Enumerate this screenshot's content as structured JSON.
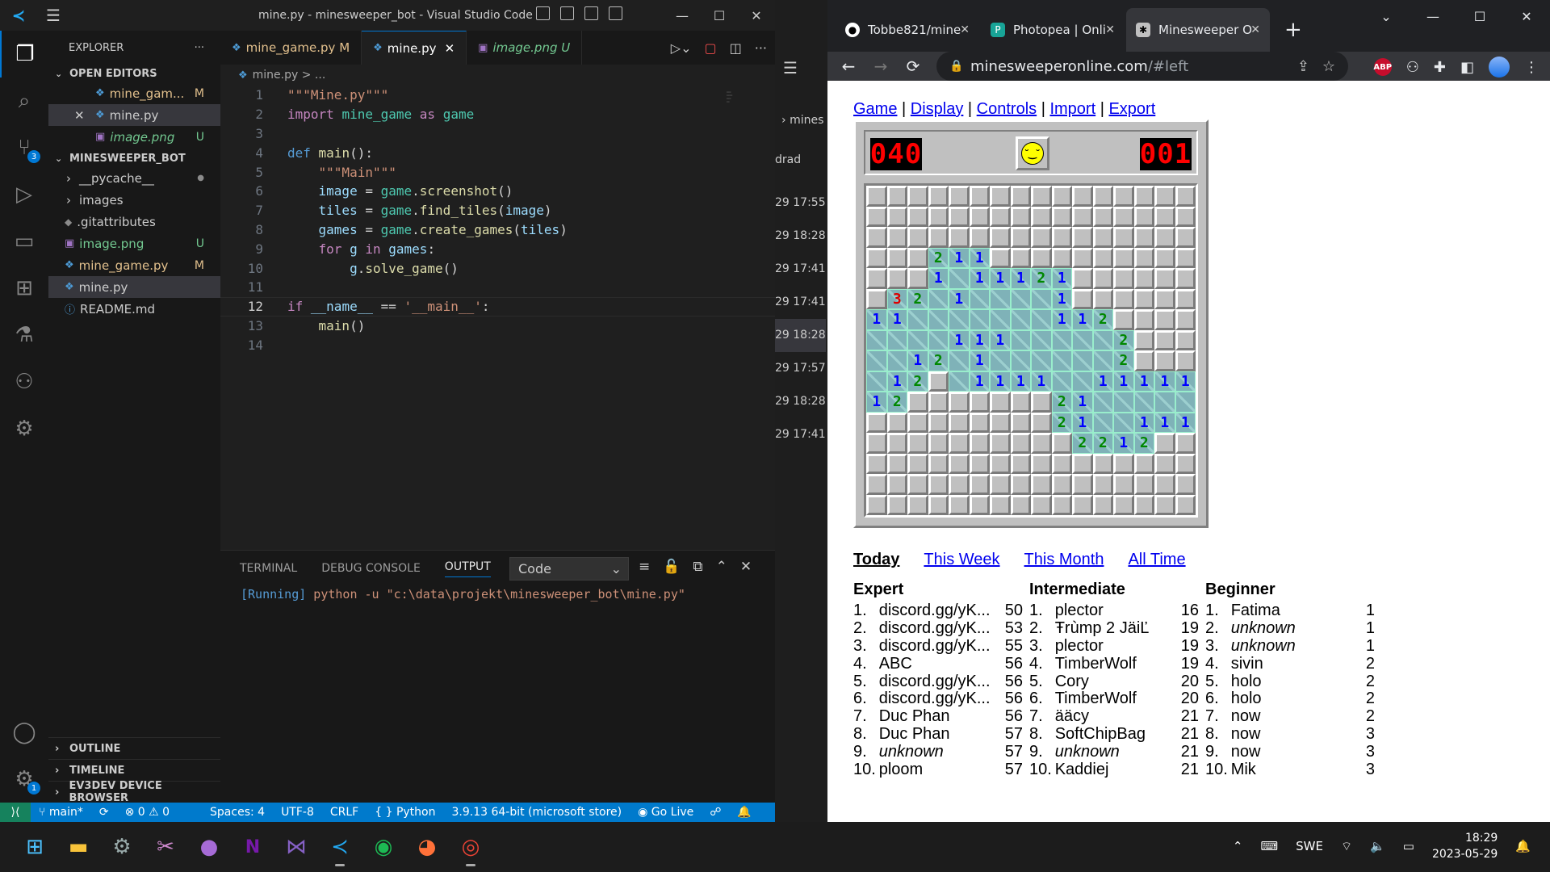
{
  "vscode": {
    "title": "mine.py - minesweeper_bot - Visual Studio Code",
    "explorer_label": "EXPLORER",
    "open_editors_label": "OPEN EDITORS",
    "open_editors": [
      {
        "name": "mine_gam...",
        "status": "M"
      },
      {
        "name": "mine.py",
        "status": ""
      },
      {
        "name": "image.png",
        "status": "U"
      }
    ],
    "workspace_label": "MINESWEEPER_BOT",
    "files": [
      {
        "name": "__pycache__",
        "status": "●"
      },
      {
        "name": "images",
        "status": ""
      },
      {
        "name": ".gitattributes",
        "status": ""
      },
      {
        "name": "image.png",
        "status": "U"
      },
      {
        "name": "mine_game.py",
        "status": "M"
      },
      {
        "name": "mine.py",
        "status": ""
      },
      {
        "name": "README.md",
        "status": ""
      }
    ],
    "bottom_sections": [
      "OUTLINE",
      "TIMELINE",
      "EV3DEV DEVICE BROWSER"
    ],
    "tabs": [
      {
        "label": "mine_game.py",
        "status": "M"
      },
      {
        "label": "mine.py",
        "status": ""
      },
      {
        "label": "image.png",
        "status": "U"
      }
    ],
    "breadcrumb": "mine.py > ...",
    "code_lines": [
      "1",
      "2",
      "3",
      "4",
      "5",
      "6",
      "7",
      "8",
      "9",
      "10",
      "11",
      "12",
      "13",
      "14"
    ],
    "panel_tabs": [
      "TERMINAL",
      "DEBUG CONSOLE",
      "OUTPUT"
    ],
    "output_select": "Code",
    "output_prefix": "[Running]",
    "output_text": " python -u \"c:\\data\\projekt\\minesweeper_bot\\mine.py\"",
    "status": {
      "branch": "main*",
      "problems": "⊗ 0 ⚠ 0",
      "spaces": "Spaces: 4",
      "encoding": "UTF-8",
      "eol": "CRLF",
      "language": "Python",
      "interpreter": "3.9.13 64-bit (microsoft store)",
      "golive": "Go Live"
    },
    "source_control_badge": "3",
    "settings_badge": "1"
  },
  "middle_window": {
    "label1": "mines",
    "label2": "drad",
    "times": [
      "29 17:55",
      "29 18:28",
      "29 17:41",
      "29 17:41",
      "29 18:28",
      "29 17:57",
      "29 18:28",
      "29 17:41"
    ]
  },
  "chrome": {
    "tabs": [
      {
        "title": "Tobbe821/mine",
        "icon": "github-icon"
      },
      {
        "title": "Photopea | Onli",
        "icon": "photopea-icon"
      },
      {
        "title": "Minesweeper O",
        "icon": "minesweeper-icon"
      }
    ],
    "url_main": "minesweeperonline.com",
    "url_rest": "/#left",
    "abp_badge": "1"
  },
  "minesweeper": {
    "menu": [
      "Game",
      "Display",
      "Controls",
      "Import",
      "Export"
    ],
    "mines_counter": "040",
    "timer": "001",
    "grid": [
      "HHHHHHHHHHHHHHHH",
      "HHHHHHHHHHHHHHHH",
      "HHHHHHHHHHHHHHHH",
      "HHH211HHHHHHHHHH",
      "HHH1O11121HHHHHH",
      "H32O1OOOO1HHHHHH",
      "11OOOOOOO112HHHH",
      "OOOO111OOOOO2HHH",
      "OO12O1OOOOOO2HHH",
      "O12HO1111OO11111",
      "12HHHHHHH21OOOOO",
      "HHHHHHHHH21OO111",
      "HHHHHHHHHH2212HH",
      "HHHHHHHHHHHHHHHH",
      "HHHHHHHHHHHHHHHH",
      "HHHHHHHHHHHHHHHH"
    ],
    "periods": [
      "Today",
      "This Week",
      "This Month",
      "All Time"
    ],
    "leaderboards": [
      {
        "title": "Expert",
        "entries": [
          {
            "rank": "1.",
            "name": "discord.gg/yK...",
            "score": "50",
            "italic": false
          },
          {
            "rank": "2.",
            "name": "discord.gg/yK...",
            "score": "53",
            "italic": false
          },
          {
            "rank": "3.",
            "name": "discord.gg/yK...",
            "score": "55",
            "italic": false
          },
          {
            "rank": "4.",
            "name": "ABC",
            "score": "56",
            "italic": false
          },
          {
            "rank": "5.",
            "name": "discord.gg/yK...",
            "score": "56",
            "italic": false
          },
          {
            "rank": "6.",
            "name": "discord.gg/yK...",
            "score": "56",
            "italic": false
          },
          {
            "rank": "7.",
            "name": "Duc Phan",
            "score": "56",
            "italic": false
          },
          {
            "rank": "8.",
            "name": "Duc Phan",
            "score": "57",
            "italic": false
          },
          {
            "rank": "9.",
            "name": "unknown",
            "score": "57",
            "italic": true
          },
          {
            "rank": "10.",
            "name": "ploom",
            "score": "57",
            "italic": false
          }
        ]
      },
      {
        "title": "Intermediate",
        "entries": [
          {
            "rank": "1.",
            "name": "plector",
            "score": "16",
            "italic": false
          },
          {
            "rank": "2.",
            "name": "Ŧrùmp 2 JäiĽ",
            "score": "19",
            "italic": false
          },
          {
            "rank": "3.",
            "name": "plector",
            "score": "19",
            "italic": false
          },
          {
            "rank": "4.",
            "name": "TimberWolf",
            "score": "19",
            "italic": false
          },
          {
            "rank": "5.",
            "name": "Cory",
            "score": "20",
            "italic": false
          },
          {
            "rank": "6.",
            "name": "TimberWolf",
            "score": "20",
            "italic": false
          },
          {
            "rank": "7.",
            "name": "ääcy",
            "score": "21",
            "italic": false
          },
          {
            "rank": "8.",
            "name": "SoftChipBag",
            "score": "21",
            "italic": false
          },
          {
            "rank": "9.",
            "name": "unknown",
            "score": "21",
            "italic": true
          },
          {
            "rank": "10.",
            "name": "Kaddiej",
            "score": "21",
            "italic": false
          }
        ]
      },
      {
        "title": "Beginner",
        "entries": [
          {
            "rank": "1.",
            "name": "Fatima",
            "score": "1",
            "italic": false
          },
          {
            "rank": "2.",
            "name": "unknown",
            "score": "1",
            "italic": true
          },
          {
            "rank": "3.",
            "name": "unknown",
            "score": "1",
            "italic": true
          },
          {
            "rank": "4.",
            "name": "sivin",
            "score": "2",
            "italic": false
          },
          {
            "rank": "5.",
            "name": "holo",
            "score": "2",
            "italic": false
          },
          {
            "rank": "6.",
            "name": "holo",
            "score": "2",
            "italic": false
          },
          {
            "rank": "7.",
            "name": "now",
            "score": "2",
            "italic": false
          },
          {
            "rank": "8.",
            "name": "now",
            "score": "3",
            "italic": false
          },
          {
            "rank": "9.",
            "name": "now",
            "score": "3",
            "italic": false
          },
          {
            "rank": "10.",
            "name": "Mik",
            "score": "3",
            "italic": false
          }
        ]
      }
    ]
  },
  "taskbar": {
    "language": "SWE",
    "time": "18:29",
    "date": "2023-05-29"
  },
  "colors": {
    "vscode_accent": "#007acc",
    "revealed_tile": "#7fb2b8",
    "hidden_tile": "#c0c0c0",
    "link": "#0000ee"
  }
}
